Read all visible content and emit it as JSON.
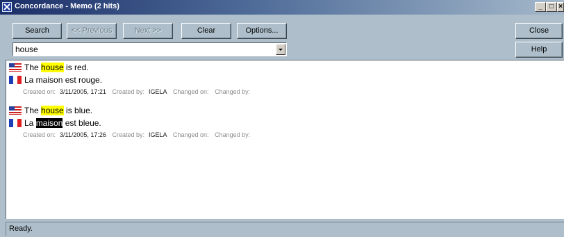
{
  "window": {
    "title": "Concordance - Memo (2 hits)"
  },
  "caption_buttons": {
    "minimize": "_",
    "maximize": "□",
    "close": "×"
  },
  "toolbar": {
    "search": "Search",
    "previous": "<< Previous",
    "next": "Next >>",
    "clear": "Clear",
    "options": "Options...",
    "close": "Close",
    "help": "Help"
  },
  "search": {
    "value": "house"
  },
  "results": [
    {
      "source_before": "The ",
      "source_hit": "house",
      "source_after": " is red.",
      "target_before": "La maison est rouge.",
      "target_hit": "",
      "target_after": "",
      "created_on_label": "Created on:",
      "created_on": "3/11/2005, 17:21",
      "created_by_label": "Created by:",
      "created_by": "IGELA",
      "changed_on_label": "Changed on:",
      "changed_by_label": "Changed by:"
    },
    {
      "source_before": "The ",
      "source_hit": "house",
      "source_after": " is blue.",
      "target_before": "La ",
      "target_hit": "maison",
      "target_after": " est bleue.",
      "created_on_label": "Created on:",
      "created_on": "3/11/2005, 17:26",
      "created_by_label": "Created by:",
      "created_by": "IGELA",
      "changed_on_label": "Changed on:",
      "changed_by_label": "Changed by:"
    }
  ],
  "flags": {
    "source": "us-flag-icon",
    "target": "fr-flag-icon"
  },
  "status": {
    "text": "Ready."
  },
  "colors": {
    "window_bg": "#aebfcb",
    "highlight": "#ffff00",
    "selection": "#000000"
  }
}
